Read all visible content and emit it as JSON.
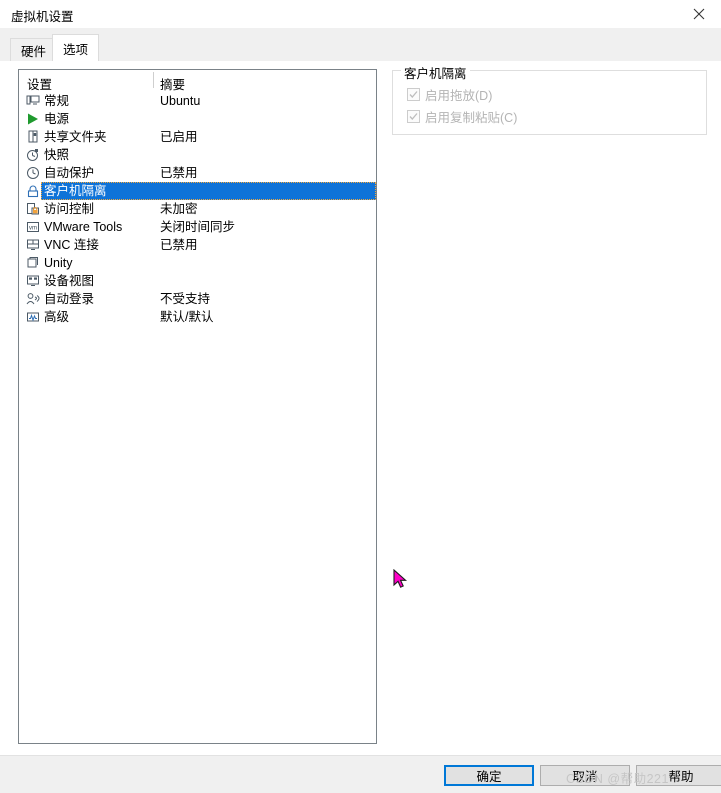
{
  "window": {
    "title": "虚拟机设置",
    "close_icon": "close-icon"
  },
  "tabs": [
    {
      "label": "硬件",
      "active": false
    },
    {
      "label": "选项",
      "active": true
    }
  ],
  "list": {
    "header": {
      "settings": "设置",
      "summary": "摘要"
    },
    "rows": [
      {
        "icon": "monitor-icon",
        "label": "常规",
        "summary": "Ubuntu",
        "selected": false
      },
      {
        "icon": "power-play-icon",
        "label": "电源",
        "summary": "",
        "selected": false
      },
      {
        "icon": "shared-folder-icon",
        "label": "共享文件夹",
        "summary": "已启用",
        "selected": false
      },
      {
        "icon": "snapshot-clock-icon",
        "label": "快照",
        "summary": "",
        "selected": false
      },
      {
        "icon": "autoprotect-icon",
        "label": "自动保护",
        "summary": "已禁用",
        "selected": false
      },
      {
        "icon": "lock-icon",
        "label": "客户机隔离",
        "summary": "",
        "selected": true
      },
      {
        "icon": "access-control-icon",
        "label": "访问控制",
        "summary": "未加密",
        "selected": false
      },
      {
        "icon": "vmware-tools-icon",
        "label": "VMware Tools",
        "summary": "关闭时间同步",
        "selected": false
      },
      {
        "icon": "vnc-icon",
        "label": "VNC 连接",
        "summary": "已禁用",
        "selected": false
      },
      {
        "icon": "unity-icon",
        "label": "Unity",
        "summary": "",
        "selected": false
      },
      {
        "icon": "device-view-icon",
        "label": "设备视图",
        "summary": "",
        "selected": false
      },
      {
        "icon": "auto-login-icon",
        "label": "自动登录",
        "summary": "不受支持",
        "selected": false
      },
      {
        "icon": "advanced-icon",
        "label": "高级",
        "summary": "默认/默认",
        "selected": false
      }
    ]
  },
  "panel": {
    "group_title": "客户机隔离",
    "checkboxes": [
      {
        "label": "启用拖放(D)",
        "checked": true,
        "disabled": true
      },
      {
        "label": "启用复制粘贴(C)",
        "checked": true,
        "disabled": true
      }
    ]
  },
  "buttons": {
    "ok": "确定",
    "cancel": "取消",
    "help": "帮助"
  },
  "watermark": "CSDN @帮助221",
  "colors": {
    "selection_blue": "#0f73d8",
    "focus_blue": "#0078d7",
    "cursor_magenta": "#ff00c8",
    "bar_gray": "#f0f0f0",
    "disabled_gray": "#b4b4b4"
  }
}
